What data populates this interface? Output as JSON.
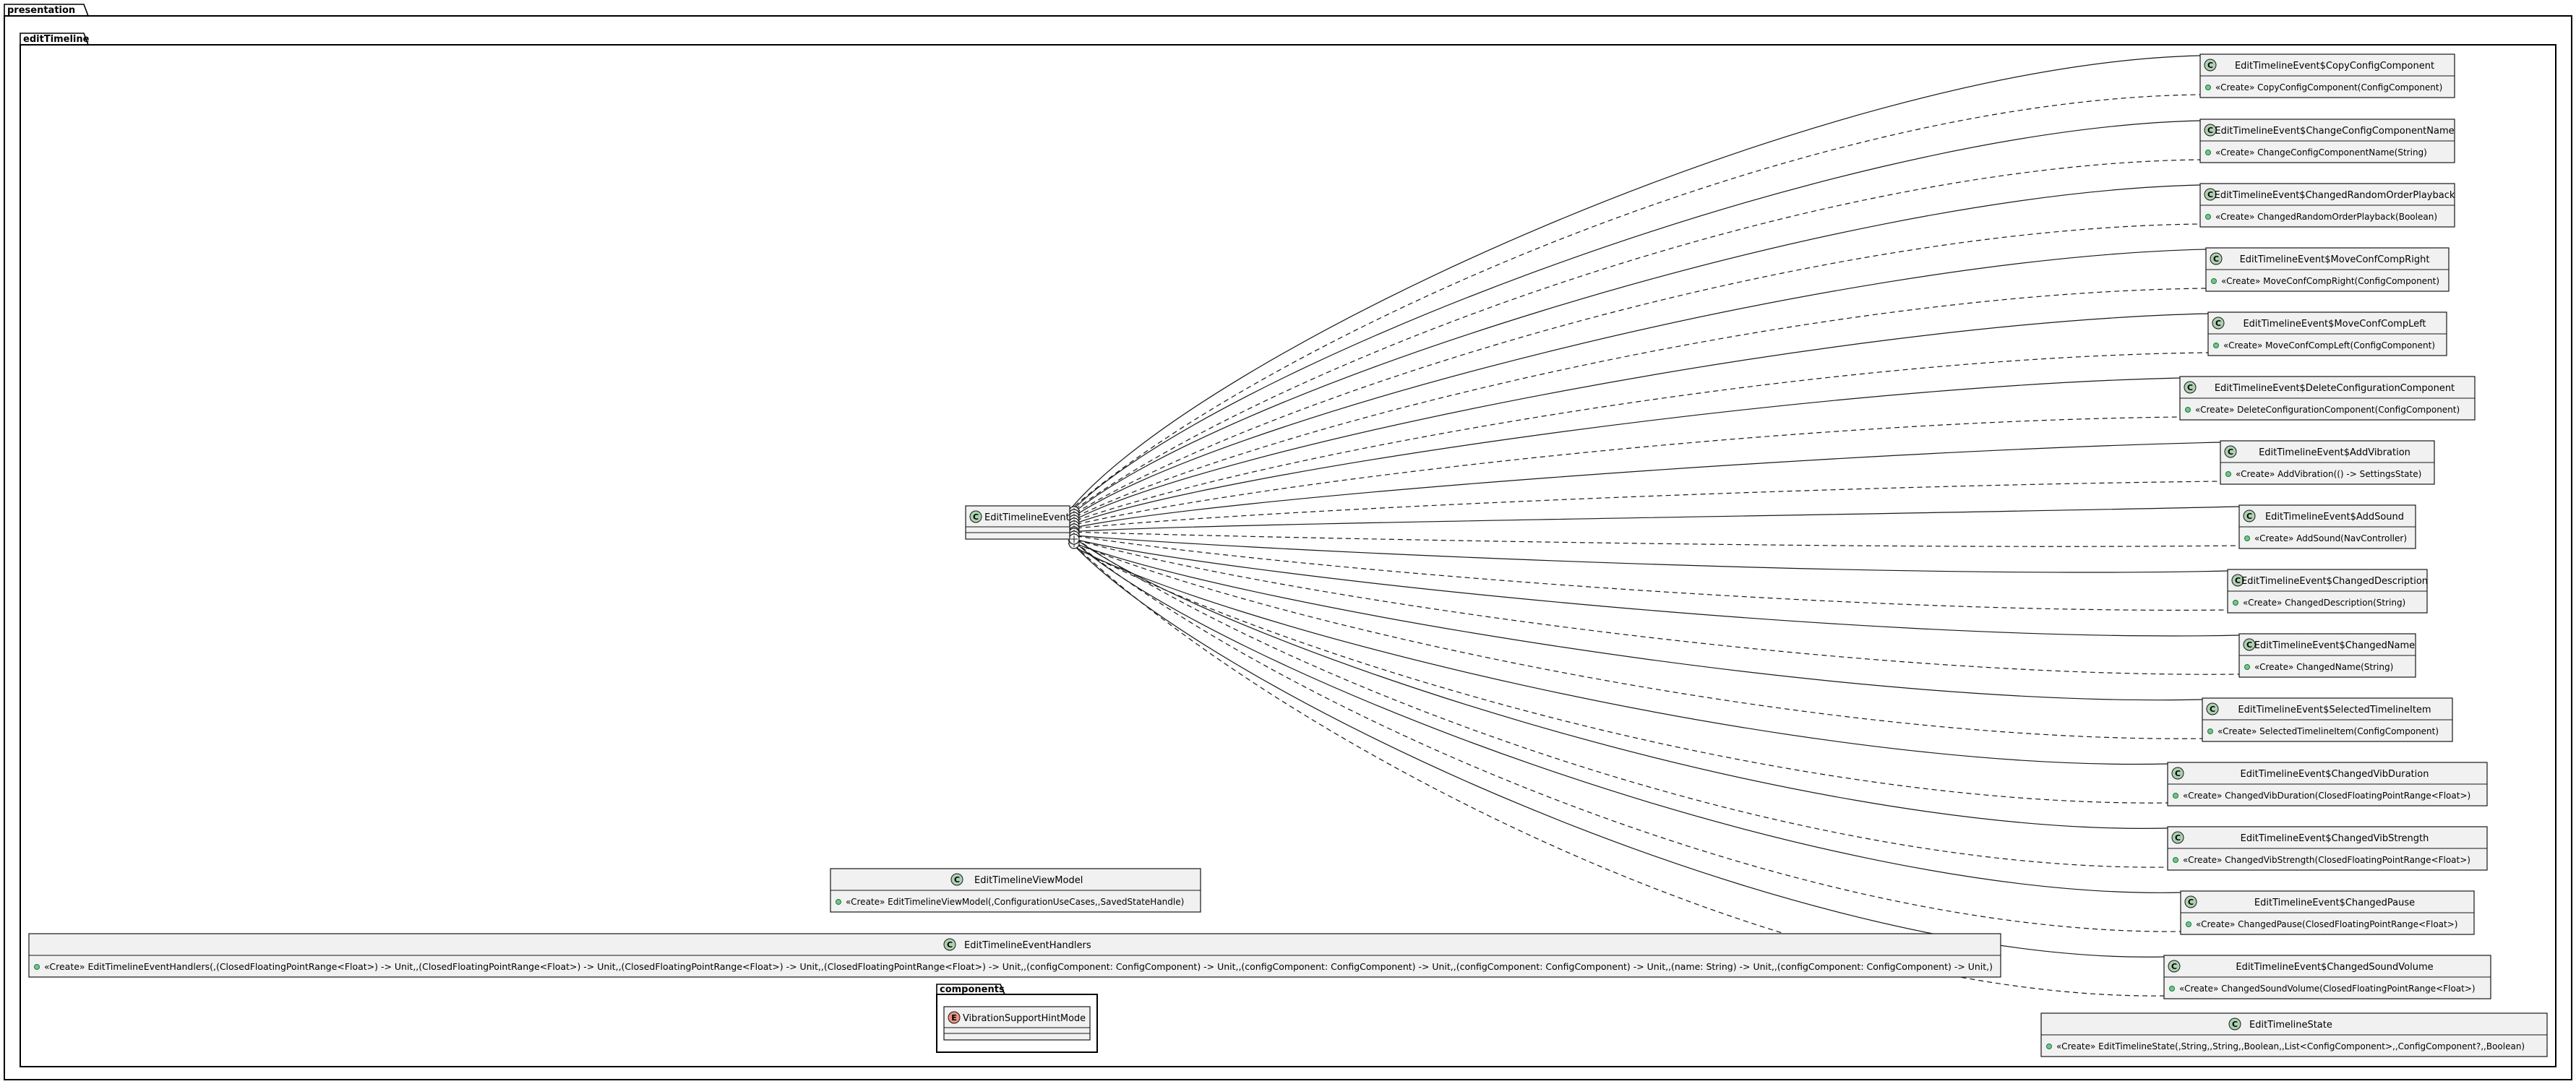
{
  "packages": {
    "presentation": "presentation",
    "edit_timeline": "editTimeline",
    "components": "components"
  },
  "colors": {
    "class_circle": "#add1b2",
    "enum_circle": "#eb937f",
    "box_fill": "#f1f1f1",
    "visibility_dot": "#84be84"
  },
  "root_class": {
    "letter": "C",
    "name": "EditTimelineEvent"
  },
  "event_classes": [
    {
      "letter": "C",
      "name": "EditTimelineEvent$CopyConfigComponent",
      "member": "«Create» CopyConfigComponent(ConfigComponent)"
    },
    {
      "letter": "C",
      "name": "EditTimelineEvent$ChangeConfigComponentName",
      "member": "«Create» ChangeConfigComponentName(String)"
    },
    {
      "letter": "C",
      "name": "EditTimelineEvent$ChangedRandomOrderPlayback",
      "member": "«Create» ChangedRandomOrderPlayback(Boolean)"
    },
    {
      "letter": "C",
      "name": "EditTimelineEvent$MoveConfCompRight",
      "member": "«Create» MoveConfCompRight(ConfigComponent)"
    },
    {
      "letter": "C",
      "name": "EditTimelineEvent$MoveConfCompLeft",
      "member": "«Create» MoveConfCompLeft(ConfigComponent)"
    },
    {
      "letter": "C",
      "name": "EditTimelineEvent$DeleteConfigurationComponent",
      "member": "«Create» DeleteConfigurationComponent(ConfigComponent)"
    },
    {
      "letter": "C",
      "name": "EditTimelineEvent$AddVibration",
      "member": "«Create» AddVibration(() -> SettingsState)"
    },
    {
      "letter": "C",
      "name": "EditTimelineEvent$AddSound",
      "member": "«Create» AddSound(NavController)"
    },
    {
      "letter": "C",
      "name": "EditTimelineEvent$ChangedDescription",
      "member": "«Create» ChangedDescription(String)"
    },
    {
      "letter": "C",
      "name": "EditTimelineEvent$ChangedName",
      "member": "«Create» ChangedName(String)"
    },
    {
      "letter": "C",
      "name": "EditTimelineEvent$SelectedTimelineItem",
      "member": "«Create» SelectedTimelineItem(ConfigComponent)"
    },
    {
      "letter": "C",
      "name": "EditTimelineEvent$ChangedVibDuration",
      "member": "«Create» ChangedVibDuration(ClosedFloatingPointRange<Float>)"
    },
    {
      "letter": "C",
      "name": "EditTimelineEvent$ChangedVibStrength",
      "member": "«Create» ChangedVibStrength(ClosedFloatingPointRange<Float>)"
    },
    {
      "letter": "C",
      "name": "EditTimelineEvent$ChangedPause",
      "member": "«Create» ChangedPause(ClosedFloatingPointRange<Float>)"
    },
    {
      "letter": "C",
      "name": "EditTimelineEvent$ChangedSoundVolume",
      "member": "«Create» ChangedSoundVolume(ClosedFloatingPointRange<Float>)"
    }
  ],
  "view_model": {
    "letter": "C",
    "name": "EditTimelineViewModel",
    "member": "«Create» EditTimelineViewModel(,ConfigurationUseCases,,SavedStateHandle)"
  },
  "handlers": {
    "letter": "C",
    "name": "EditTimelineEventHandlers",
    "member": "«Create» EditTimelineEventHandlers(,(ClosedFloatingPointRange<Float>) -> Unit,,(ClosedFloatingPointRange<Float>) -> Unit,,(ClosedFloatingPointRange<Float>) -> Unit,,(ClosedFloatingPointRange<Float>) -> Unit,,(configComponent: ConfigComponent) -> Unit,,(configComponent: ConfigComponent) -> Unit,,(configComponent: ConfigComponent) -> Unit,,(name: String) -> Unit,,(configComponent: ConfigComponent) -> Unit,)"
  },
  "state": {
    "letter": "C",
    "name": "EditTimelineState",
    "member": "«Create» EditTimelineState(,String,,String,,Boolean,,List<ConfigComponent>,,ConfigComponent?,,Boolean)"
  },
  "enum_class": {
    "letter": "E",
    "name": "VibrationSupportHintMode"
  }
}
